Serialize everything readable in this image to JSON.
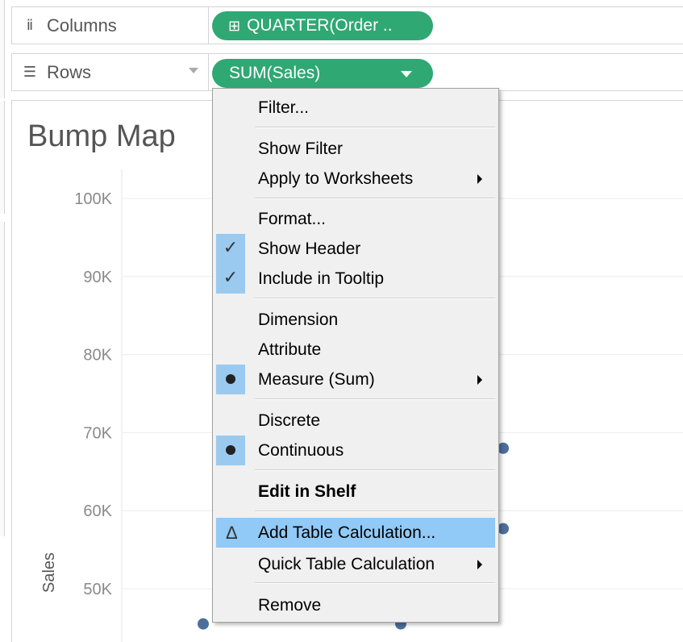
{
  "shelves": {
    "columns": {
      "icon": "columns-icon",
      "label": "Columns",
      "pill": "QUARTER(Order ..",
      "pill_icon": "plus-box-icon"
    },
    "rows": {
      "icon": "rows-icon",
      "label": "Rows",
      "pill": "SUM(Sales)"
    }
  },
  "chart": {
    "title": "Bump Map"
  },
  "chart_data": {
    "type": "scatter",
    "title": "Bump Map",
    "ylabel": "Sales",
    "xlabel": "",
    "y_ticks": [
      "100K",
      "90K",
      "80K",
      "70K",
      "60K",
      "50K"
    ],
    "y_tick_values": [
      100000,
      90000,
      80000,
      70000,
      60000,
      50000
    ],
    "grid": true,
    "points": [
      {
        "y": 45500
      },
      {
        "y": 45500
      },
      {
        "y": 68000
      },
      {
        "y": 57700
      }
    ]
  },
  "menu": {
    "items": [
      {
        "label": "Filter...",
        "icon": ""
      },
      {
        "label": "Show Filter"
      },
      {
        "label": "Apply to Worksheets",
        "submenu": true
      },
      {
        "label": "Format..."
      },
      {
        "label": "Show Header",
        "checked": true
      },
      {
        "label": "Include in Tooltip",
        "checked": true
      },
      {
        "label": "Dimension"
      },
      {
        "label": "Attribute"
      },
      {
        "label": "Measure (Sum)",
        "selected": true,
        "submenu": true
      },
      {
        "label": "Discrete"
      },
      {
        "label": "Continuous",
        "selected": true
      },
      {
        "label": "Edit in Shelf",
        "bold": true
      },
      {
        "label": "Add Table Calculation...",
        "highlighted": true,
        "icon": "delta-icon"
      },
      {
        "label": "Quick Table Calculation",
        "submenu": true
      },
      {
        "label": "Remove"
      }
    ]
  },
  "colors": {
    "pill": "#2fa874",
    "point": "#4e6e9c",
    "menu_highlight": "#91c9f7",
    "check_box": "#9bcaf0"
  }
}
